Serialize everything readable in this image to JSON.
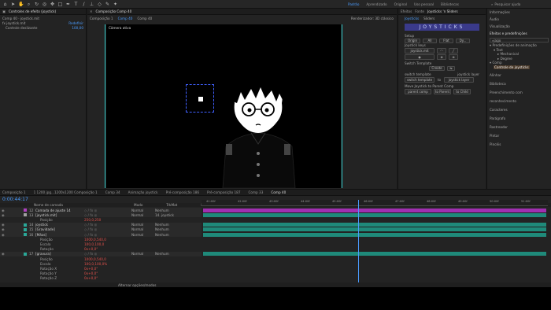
{
  "topbar": {
    "workspaces": [
      "Padrão",
      "Aprendizado",
      "Original",
      "Uso pessoal",
      "Bibliotecas"
    ],
    "active_workspace": "Padrão",
    "search_placeholder": "Pesquisar ajuda"
  },
  "project_panel": {
    "tab_label": "Controles de efeito (joystick)",
    "comp_path": "Comp 40 · joystick.mit",
    "effects": [
      {
        "name": "joystick.mit",
        "value": "Redefinir"
      },
      {
        "name": "Controle deslizante",
        "value": "100,00"
      }
    ]
  },
  "composition": {
    "tab_label": "Composição Comp 40",
    "breadcrumbs": [
      "Composição 1",
      "Comp 40",
      "Comp 40"
    ],
    "renderer_label": "Renderizador:",
    "renderer_value": "3D clássico",
    "viewer_label": "Câmera ativa",
    "zoom": "12%",
    "timecode": "0:00:44:17",
    "quality": "Quarto",
    "camera": "Câmera ativa",
    "views": "1 exibi..."
  },
  "joysticks_panel": {
    "tabs": [
      "Efeitos",
      "Fonte",
      "Joysticks 'n Sliders"
    ],
    "subtabs": [
      "Joysticks",
      "Sliders"
    ],
    "title": "JOYSTICKS",
    "setup_label": "Setup",
    "origin_labels": [
      "Origin",
      "All",
      "Flat",
      "Dy..."
    ],
    "joystick_keys_label": "Joystick keys",
    "joystick_value": "joystick.mit",
    "switch_template_label": "Switch Template",
    "create_label": "Create",
    "switch_template2_label": "switch template",
    "joystick_layer_label": "joystick layer",
    "switch_template_value": "switch template",
    "joystick_layer_value": "joystick layer",
    "move_label": "Move Joystick to Parent Comp",
    "parent_comp_value": "parent comp",
    "to_parent_label": "to Parent",
    "to_child_label": "to Child"
  },
  "info_panel": {
    "items": [
      "Informações",
      "Áudio",
      "Visualização"
    ],
    "effects_presets": "Efeitos e predefinições",
    "search_value": "jago",
    "tree": [
      "Predefinições de animação",
      "Text",
      "Mechanical",
      "Degree",
      "Comp",
      "Controle de joysticks"
    ],
    "panels": [
      "Alinhar",
      "Biblioteca",
      "Preenchimento com reconhecimento",
      "Caracteres",
      "Parágrafo",
      "Rastreador",
      "Pintar",
      "Pincéis"
    ]
  },
  "timeline": {
    "tabs": [
      "Composição 1",
      "1 1200 jpg...1200x1200 Composição 1",
      "Comp 34",
      "Animação joystick",
      "Pré-composição 186",
      "Pré-composição 187",
      "Comp 33",
      "Comp 40"
    ],
    "active_tab": "Comp 40",
    "timecode": "0:00:44:17",
    "columns": [
      "Nome de camada",
      "Modo",
      "T",
      "TrkMat",
      "Pai e vinculo"
    ],
    "ruler": [
      "41:00f",
      "42:00f",
      "43:00f",
      "44:00f",
      "45:00f",
      "46:00f",
      "47:00f",
      "48:00f",
      "49:00f",
      "50:00f",
      "51:00f"
    ],
    "layers": [
      {
        "num": "12",
        "name": "Camada de ajuste 14",
        "mode": "Normal",
        "parent": "Nenhum",
        "color": "#b040c0"
      },
      {
        "num": "13",
        "name": "[joystick.mit]",
        "mode": "Normal",
        "parent": "14. joystick",
        "color": "#a0a0a0"
      },
      {
        "num": "",
        "name": "Posição",
        "value": "250,0,250",
        "mode": "",
        "parent": "",
        "color": ""
      },
      {
        "num": "14",
        "name": "joystick",
        "mode": "Normal",
        "parent": "Nenhum",
        "color": "#2aa898"
      },
      {
        "num": "15",
        "name": "[Gravidade]",
        "mode": "Normal",
        "parent": "Nenhum",
        "color": "#2aa898"
      },
      {
        "num": "16",
        "name": "[Mãos]",
        "mode": "Normal",
        "parent": "Nenhum",
        "color": "#2aa898"
      },
      {
        "num": "",
        "name": "Posição",
        "value": "1000,0,540,0",
        "mode": "",
        "parent": "",
        "color": ""
      },
      {
        "num": "",
        "name": "Escala",
        "value": "100,0,100,0",
        "mode": "",
        "parent": "",
        "color": ""
      },
      {
        "num": "",
        "name": "Rotação",
        "value": "0x+0,0°",
        "mode": "",
        "parent": "",
        "color": ""
      },
      {
        "num": "17",
        "name": "[gravura]",
        "mode": "Normal",
        "parent": "Nenhum",
        "color": "#2aa898"
      },
      {
        "num": "",
        "name": "Posição",
        "value": "1000,0,540,0",
        "mode": "",
        "parent": "",
        "color": ""
      },
      {
        "num": "",
        "name": "Escala",
        "value": "100,0,100,0%",
        "mode": "",
        "parent": "",
        "color": ""
      },
      {
        "num": "",
        "name": "Rotação X",
        "value": "0x+0,0°",
        "mode": "",
        "parent": "",
        "color": ""
      },
      {
        "num": "",
        "name": "Rotação Y",
        "value": "0x+0,0°",
        "mode": "",
        "parent": "",
        "color": ""
      },
      {
        "num": "",
        "name": "Rotação Z",
        "value": "0x+0,0°",
        "mode": "",
        "parent": "",
        "color": ""
      }
    ],
    "footer": "Alternar opções/modos"
  },
  "colors": {
    "accent": "#4a9cff",
    "purple_bar": "#a030b0",
    "teal_bar": "#1f8a7a",
    "playhead": "#4a9cff"
  }
}
